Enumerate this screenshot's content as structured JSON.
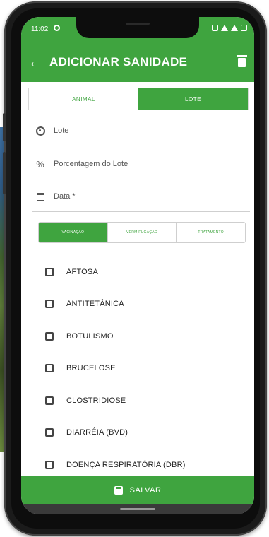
{
  "status_bar": {
    "time": "11:02"
  },
  "app_bar": {
    "title": "ADICIONAR SANIDADE"
  },
  "tabs": [
    {
      "label": "ANIMAL",
      "selected": false
    },
    {
      "label": "LOTE",
      "selected": true
    }
  ],
  "fields": {
    "lote": {
      "label": "Lote"
    },
    "porcentagem": {
      "label": "Porcentagem do Lote"
    },
    "data": {
      "label": "Data *"
    }
  },
  "type_tabs": [
    {
      "label": "VACINAÇÃO",
      "selected": true
    },
    {
      "label": "VERMIFUGAÇÃO",
      "selected": false
    },
    {
      "label": "TRATAMENTO",
      "selected": false
    }
  ],
  "items": [
    "AFTOSA",
    "ANTITETÂNICA",
    "BOTULISMO",
    "BRUCELOSE",
    "CLOSTRIDIOSE",
    "DIARRÉIA (BVD)",
    "DOENÇA RESPIRATÓRIA (DBR)"
  ],
  "save_button": {
    "label": "SALVAR"
  },
  "colors": {
    "primary": "#3fa43f",
    "frame": "#1b1b1b"
  },
  "icons": {
    "back": "arrow-left-icon",
    "delete": "trash-icon",
    "lote": "palette-icon",
    "percent": "percent-icon",
    "date": "calendar-icon",
    "save": "floppy-icon"
  }
}
